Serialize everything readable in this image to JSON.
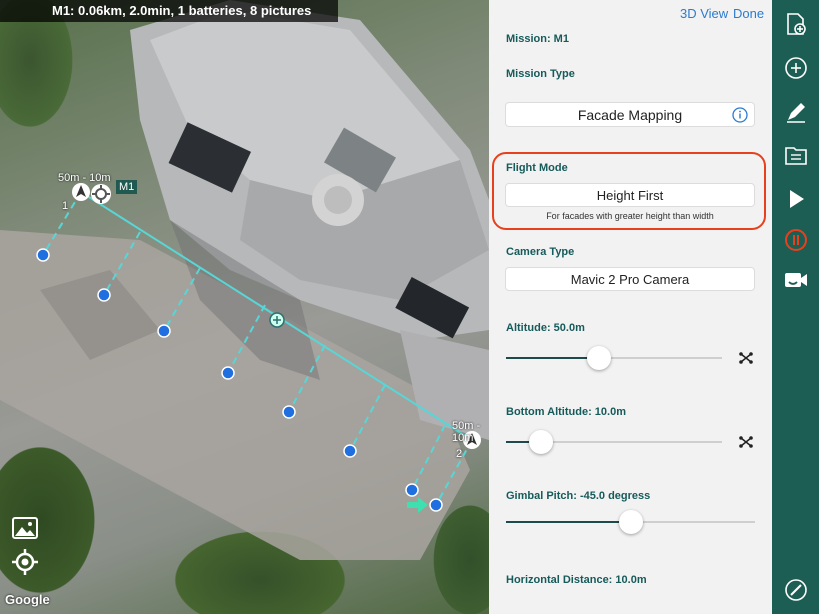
{
  "map": {
    "summary": "M1: 0.06km, 2.0min, 1 batteries, 8 pictures",
    "mission_tag": "M1",
    "point1_label": "50m - 10m",
    "point1_number": "1",
    "point2_label": "50m - 10m",
    "point2_number": "2",
    "google": "Google",
    "icons": [
      "image-layer-icon",
      "locate-icon"
    ]
  },
  "panel": {
    "view_3d": "3D View",
    "done": "Done",
    "mission_name": "Mission: M1",
    "mission_type_label": "Mission Type",
    "mission_type_value": "Facade Mapping",
    "flight_mode_label": "Flight Mode",
    "flight_mode_value": "Height First",
    "flight_mode_hint": "For facades with greater height than width",
    "camera_type_label": "Camera Type",
    "camera_type_value": "Mavic 2 Pro Camera",
    "altitude_label": "Altitude: 50.0m",
    "altitude_fraction": 0.42,
    "bottom_altitude_label": "Bottom Altitude: 10.0m",
    "bottom_altitude_fraction": 0.12,
    "gimbal_pitch_label": "Gimbal Pitch: -45.0 degress",
    "gimbal_pitch_fraction": 0.5,
    "horizontal_distance_label": "Horizontal Distance: 10.0m"
  },
  "toolbar": {
    "items": [
      "new-document-icon",
      "add-icon",
      "edit-icon",
      "folder-icon",
      "play-icon",
      "stop-icon",
      "video-camera-icon",
      "compass-icon"
    ],
    "accent": "#1d5e54",
    "stop_color": "#e8401c"
  }
}
